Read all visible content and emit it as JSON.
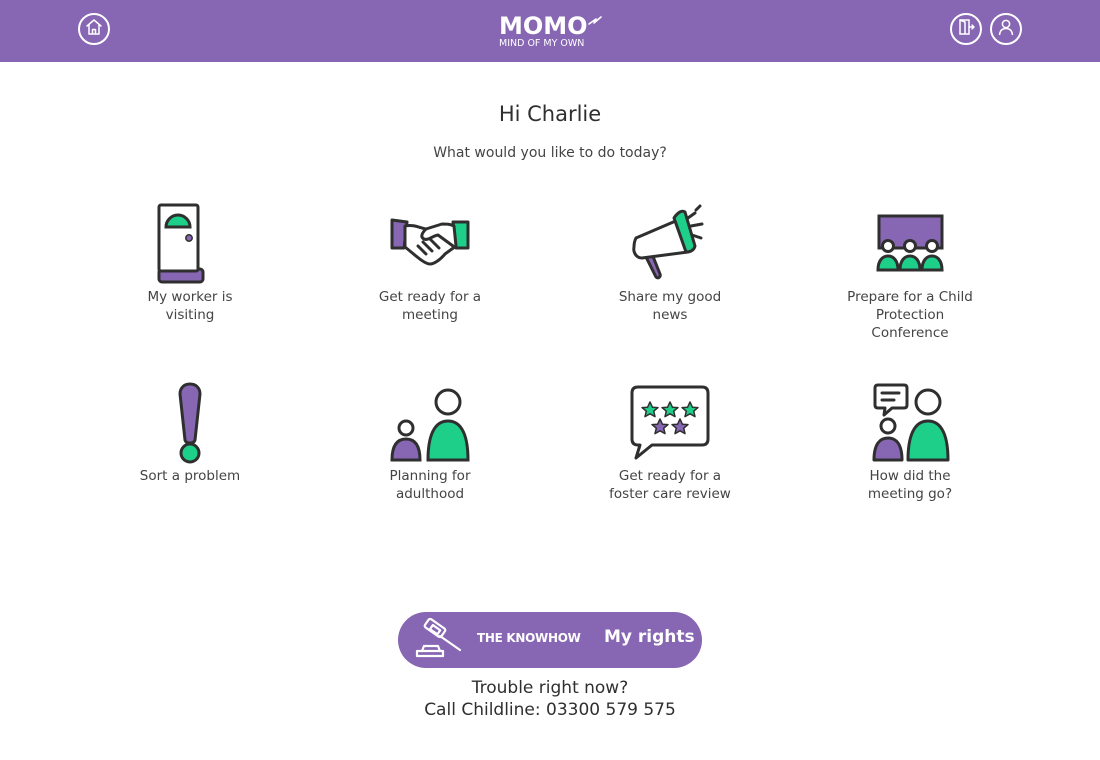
{
  "header": {
    "logo_text": "MOMO",
    "logo_subtitle": "MIND OF MY OWN",
    "home_icon": "home-icon",
    "exit_icon": "exit-door-icon",
    "profile_icon": "user-profile-icon",
    "brand_color": "#8766b3"
  },
  "main": {
    "greeting": "Hi Charlie",
    "subtitle": "What would you like to do today?",
    "tiles": [
      {
        "label": "My worker is visiting",
        "icon": "door-icon"
      },
      {
        "label": "Get ready for a meeting",
        "icon": "handshake-icon"
      },
      {
        "label": "Share my good news",
        "icon": "megaphone-icon"
      },
      {
        "label": "Prepare for a Child Protection Conference",
        "icon": "conference-group-icon"
      },
      {
        "label": "Sort a problem",
        "icon": "exclamation-icon"
      },
      {
        "label": "Planning for adulthood",
        "icon": "adult-child-icon"
      },
      {
        "label": "Get ready for a foster care review",
        "icon": "star-rating-chat-icon"
      },
      {
        "label": "How did the meeting go?",
        "icon": "meeting-feedback-icon"
      }
    ],
    "accent_green": "#1ecf8a",
    "accent_purple": "#8766b3"
  },
  "footer": {
    "knowhow_label": "THE KNOWHOW",
    "rights_label": "My rights",
    "rights_icon": "gavel-icon",
    "trouble_text": "Trouble right now?",
    "childline_text": "Call Childline: 03300 579 575"
  }
}
